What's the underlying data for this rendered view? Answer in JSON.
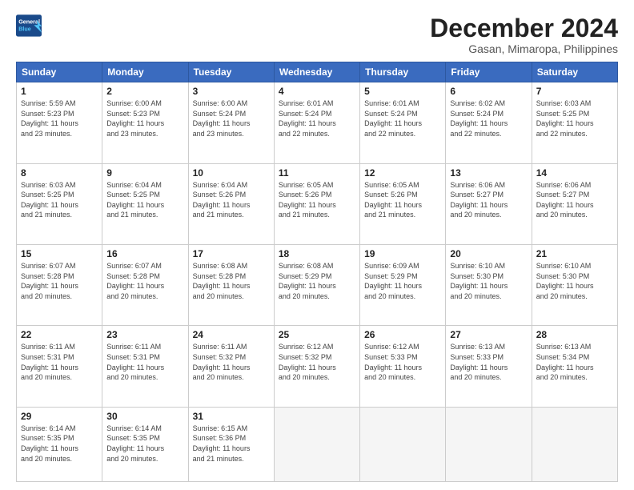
{
  "header": {
    "logo_line1": "General",
    "logo_line2": "Blue",
    "month": "December 2024",
    "location": "Gasan, Mimaropa, Philippines"
  },
  "weekdays": [
    "Sunday",
    "Monday",
    "Tuesday",
    "Wednesday",
    "Thursday",
    "Friday",
    "Saturday"
  ],
  "weeks": [
    [
      {
        "day": "1",
        "info": "Sunrise: 5:59 AM\nSunset: 5:23 PM\nDaylight: 11 hours\nand 23 minutes."
      },
      {
        "day": "2",
        "info": "Sunrise: 6:00 AM\nSunset: 5:23 PM\nDaylight: 11 hours\nand 23 minutes."
      },
      {
        "day": "3",
        "info": "Sunrise: 6:00 AM\nSunset: 5:24 PM\nDaylight: 11 hours\nand 23 minutes."
      },
      {
        "day": "4",
        "info": "Sunrise: 6:01 AM\nSunset: 5:24 PM\nDaylight: 11 hours\nand 22 minutes."
      },
      {
        "day": "5",
        "info": "Sunrise: 6:01 AM\nSunset: 5:24 PM\nDaylight: 11 hours\nand 22 minutes."
      },
      {
        "day": "6",
        "info": "Sunrise: 6:02 AM\nSunset: 5:24 PM\nDaylight: 11 hours\nand 22 minutes."
      },
      {
        "day": "7",
        "info": "Sunrise: 6:03 AM\nSunset: 5:25 PM\nDaylight: 11 hours\nand 22 minutes."
      }
    ],
    [
      {
        "day": "8",
        "info": "Sunrise: 6:03 AM\nSunset: 5:25 PM\nDaylight: 11 hours\nand 21 minutes."
      },
      {
        "day": "9",
        "info": "Sunrise: 6:04 AM\nSunset: 5:25 PM\nDaylight: 11 hours\nand 21 minutes."
      },
      {
        "day": "10",
        "info": "Sunrise: 6:04 AM\nSunset: 5:26 PM\nDaylight: 11 hours\nand 21 minutes."
      },
      {
        "day": "11",
        "info": "Sunrise: 6:05 AM\nSunset: 5:26 PM\nDaylight: 11 hours\nand 21 minutes."
      },
      {
        "day": "12",
        "info": "Sunrise: 6:05 AM\nSunset: 5:26 PM\nDaylight: 11 hours\nand 21 minutes."
      },
      {
        "day": "13",
        "info": "Sunrise: 6:06 AM\nSunset: 5:27 PM\nDaylight: 11 hours\nand 20 minutes."
      },
      {
        "day": "14",
        "info": "Sunrise: 6:06 AM\nSunset: 5:27 PM\nDaylight: 11 hours\nand 20 minutes."
      }
    ],
    [
      {
        "day": "15",
        "info": "Sunrise: 6:07 AM\nSunset: 5:28 PM\nDaylight: 11 hours\nand 20 minutes."
      },
      {
        "day": "16",
        "info": "Sunrise: 6:07 AM\nSunset: 5:28 PM\nDaylight: 11 hours\nand 20 minutes."
      },
      {
        "day": "17",
        "info": "Sunrise: 6:08 AM\nSunset: 5:28 PM\nDaylight: 11 hours\nand 20 minutes."
      },
      {
        "day": "18",
        "info": "Sunrise: 6:08 AM\nSunset: 5:29 PM\nDaylight: 11 hours\nand 20 minutes."
      },
      {
        "day": "19",
        "info": "Sunrise: 6:09 AM\nSunset: 5:29 PM\nDaylight: 11 hours\nand 20 minutes."
      },
      {
        "day": "20",
        "info": "Sunrise: 6:10 AM\nSunset: 5:30 PM\nDaylight: 11 hours\nand 20 minutes."
      },
      {
        "day": "21",
        "info": "Sunrise: 6:10 AM\nSunset: 5:30 PM\nDaylight: 11 hours\nand 20 minutes."
      }
    ],
    [
      {
        "day": "22",
        "info": "Sunrise: 6:11 AM\nSunset: 5:31 PM\nDaylight: 11 hours\nand 20 minutes."
      },
      {
        "day": "23",
        "info": "Sunrise: 6:11 AM\nSunset: 5:31 PM\nDaylight: 11 hours\nand 20 minutes."
      },
      {
        "day": "24",
        "info": "Sunrise: 6:11 AM\nSunset: 5:32 PM\nDaylight: 11 hours\nand 20 minutes."
      },
      {
        "day": "25",
        "info": "Sunrise: 6:12 AM\nSunset: 5:32 PM\nDaylight: 11 hours\nand 20 minutes."
      },
      {
        "day": "26",
        "info": "Sunrise: 6:12 AM\nSunset: 5:33 PM\nDaylight: 11 hours\nand 20 minutes."
      },
      {
        "day": "27",
        "info": "Sunrise: 6:13 AM\nSunset: 5:33 PM\nDaylight: 11 hours\nand 20 minutes."
      },
      {
        "day": "28",
        "info": "Sunrise: 6:13 AM\nSunset: 5:34 PM\nDaylight: 11 hours\nand 20 minutes."
      }
    ],
    [
      {
        "day": "29",
        "info": "Sunrise: 6:14 AM\nSunset: 5:35 PM\nDaylight: 11 hours\nand 20 minutes."
      },
      {
        "day": "30",
        "info": "Sunrise: 6:14 AM\nSunset: 5:35 PM\nDaylight: 11 hours\nand 20 minutes."
      },
      {
        "day": "31",
        "info": "Sunrise: 6:15 AM\nSunset: 5:36 PM\nDaylight: 11 hours\nand 21 minutes."
      },
      {
        "day": "",
        "info": ""
      },
      {
        "day": "",
        "info": ""
      },
      {
        "day": "",
        "info": ""
      },
      {
        "day": "",
        "info": ""
      }
    ]
  ]
}
